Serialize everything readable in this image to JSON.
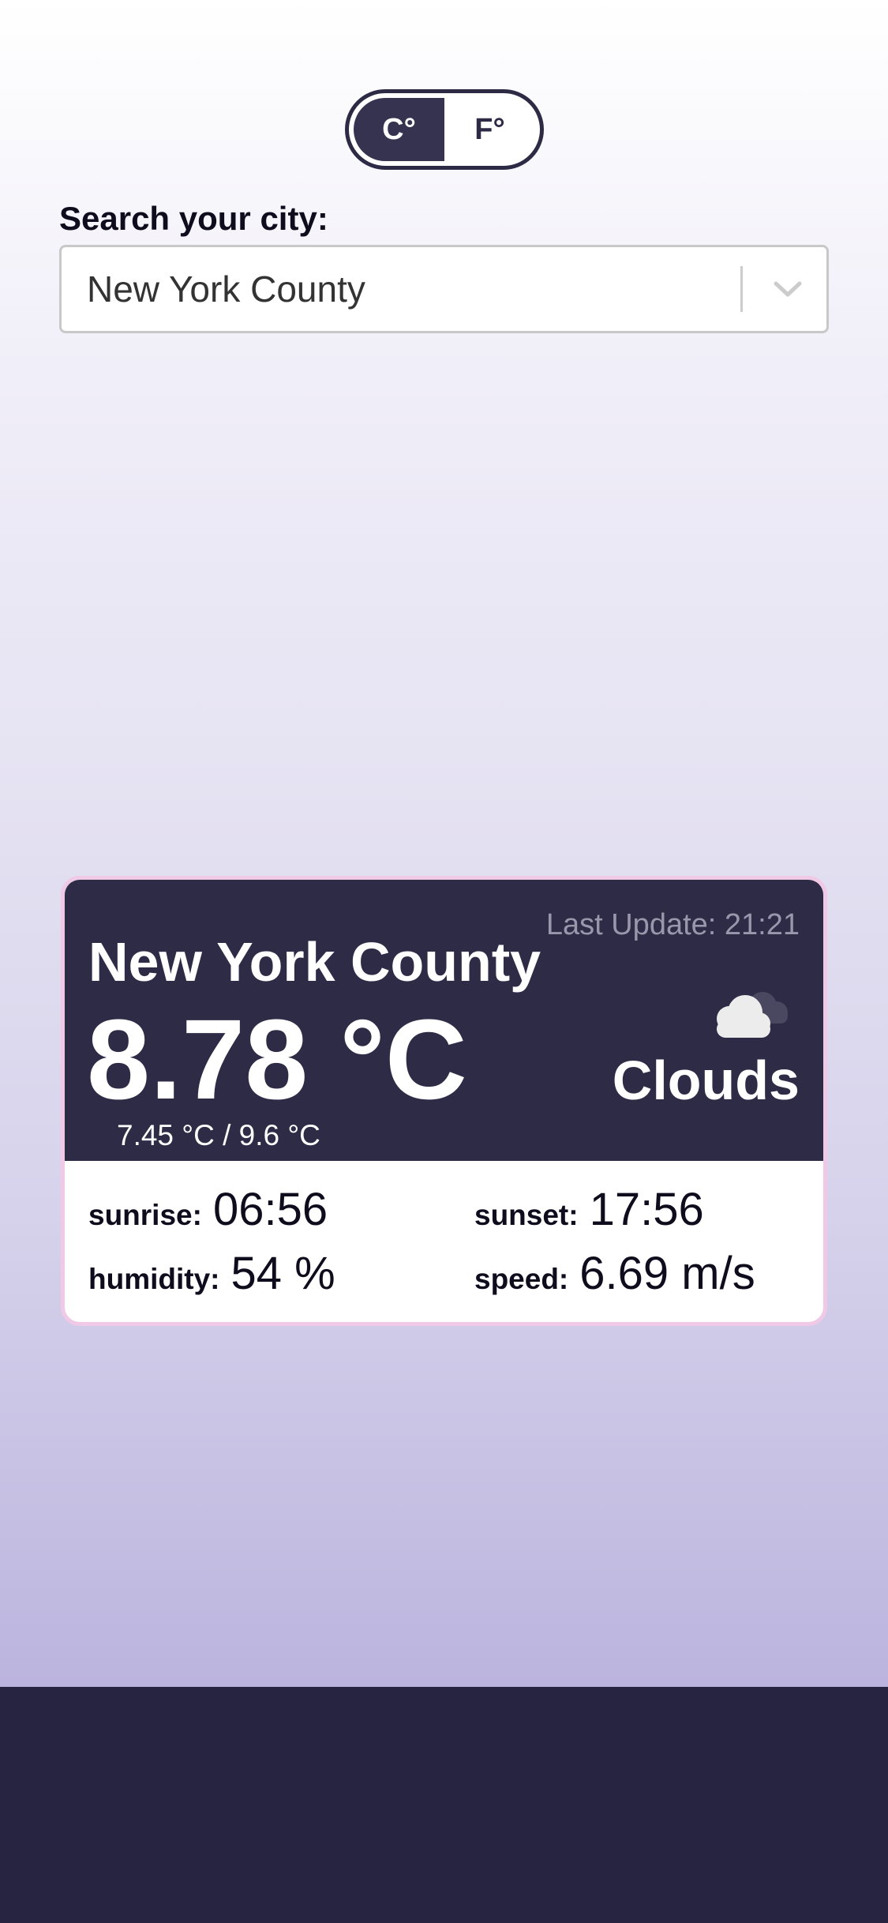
{
  "unit_toggle": {
    "celsius_label": "C°",
    "fahrenheit_label": "F°",
    "selected": "C°"
  },
  "search": {
    "label": "Search your city:",
    "value": "New York County"
  },
  "weather": {
    "last_update": "Last Update: 21:21",
    "city": "New York County",
    "temperature": "8.78 °C",
    "temp_range": "7.45 °C / 9.6 °C",
    "condition": "Clouds",
    "icon": "clouds-icon",
    "stats": {
      "sunrise_label": "sunrise:",
      "sunrise_value": "06:56",
      "sunset_label": "sunset:",
      "sunset_value": "17:56",
      "humidity_label": "humidity:",
      "humidity_value": "54 %",
      "speed_label": "speed:",
      "speed_value": "6.69 m/s"
    }
  },
  "colors": {
    "card_dark": "#2e2b47",
    "card_border": "#efc9e6",
    "footer": "#272442",
    "toggle_active": "#363350"
  }
}
